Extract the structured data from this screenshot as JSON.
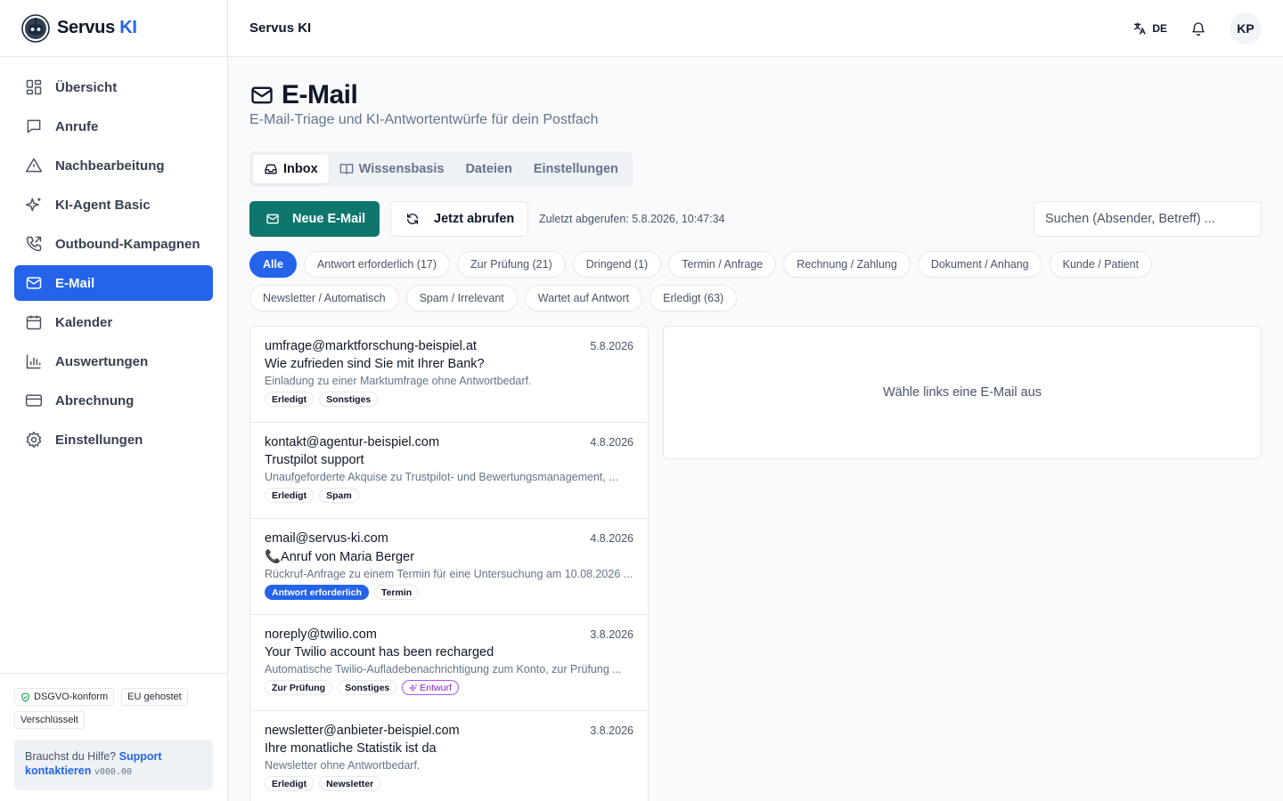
{
  "brand": {
    "name": "Servus",
    "accent": "KI",
    "accent_color": "#2563eb"
  },
  "sidebar": {
    "items": [
      {
        "label": "Übersicht",
        "icon": "grid-icon"
      },
      {
        "label": "Anrufe",
        "icon": "chat-bubble-icon"
      },
      {
        "label": "Nachbearbeitung",
        "icon": "warning-triangle-icon"
      },
      {
        "label": "KI-Agent Basic",
        "icon": "sparkles-icon"
      },
      {
        "label": "Outbound-Kampagnen",
        "icon": "phone-outgoing-icon"
      },
      {
        "label": "E-Mail",
        "icon": "mail-icon",
        "active": true
      },
      {
        "label": "Kalender",
        "icon": "calendar-icon"
      },
      {
        "label": "Auswertungen",
        "icon": "bar-chart-icon"
      },
      {
        "label": "Abrechnung",
        "icon": "credit-card-icon"
      },
      {
        "label": "Einstellungen",
        "icon": "gear-icon"
      }
    ],
    "badges": [
      "DSGVO-konform",
      "EU gehostet",
      "Verschlüsselt"
    ],
    "help": {
      "text": "Brauchst du Hilfe?",
      "link": "Support kontaktieren",
      "version": "v000.00"
    }
  },
  "topbar": {
    "title": "Servus KI",
    "language": "DE",
    "avatar": "KP"
  },
  "page": {
    "title": "E-Mail",
    "subtitle": "E-Mail-Triage und KI-Antwortentwürfe für dein Postfach",
    "tabs": [
      {
        "label": "Inbox",
        "icon": "inbox-icon",
        "active": true
      },
      {
        "label": "Wissensbasis",
        "icon": "book-icon"
      },
      {
        "label": "Dateien"
      },
      {
        "label": "Einstellungen"
      }
    ],
    "actions": {
      "new_mail": "Neue E-Mail",
      "fetch_now": "Jetzt abrufen",
      "last_fetched": "Zuletzt abgerufen: 5.8.2026, 10:47:34",
      "search_placeholder": "Suchen (Absender, Betreff) ..."
    },
    "filters": [
      {
        "label": "Alle",
        "active": true
      },
      {
        "label": "Antwort erforderlich (17)"
      },
      {
        "label": "Zur Prüfung (21)"
      },
      {
        "label": "Dringend (1)"
      },
      {
        "label": "Termin / Anfrage"
      },
      {
        "label": "Rechnung / Zahlung"
      },
      {
        "label": "Dokument / Anhang"
      },
      {
        "label": "Kunde / Patient"
      },
      {
        "label": "Newsletter / Automatisch"
      },
      {
        "label": "Spam / Irrelevant"
      },
      {
        "label": "Wartet auf Antwort"
      },
      {
        "label": "Erledigt (63)"
      }
    ],
    "emails": [
      {
        "sender": "umfrage@marktforschung-beispiel.at",
        "date": "5.8.2026",
        "subject": "Wie zufrieden sind Sie mit Ihrer Bank?",
        "preview": "Einladung zu einer Marktumfrage ohne Antwortbedarf.",
        "tags": [
          {
            "label": "Erledigt"
          },
          {
            "label": "Sonstiges"
          }
        ]
      },
      {
        "sender": "kontakt@agentur-beispiel.com",
        "date": "4.8.2026",
        "subject": "Trustpilot support",
        "preview": "Unaufgeforderte Akquise zu Trustpilot- und Bewertungsmanagement, ...",
        "tags": [
          {
            "label": "Erledigt"
          },
          {
            "label": "Spam"
          }
        ]
      },
      {
        "sender": "email@servus-ki.com",
        "date": "4.8.2026",
        "subject": "📞Anruf von Maria Berger",
        "preview": "Rückruf-Anfrage zu einem Termin für eine Untersuchung am 10.08.2026 ...",
        "tags": [
          {
            "label": "Antwort erforderlich",
            "style": "blue"
          },
          {
            "label": "Termin"
          }
        ]
      },
      {
        "sender": "noreply@twilio.com",
        "date": "3.8.2026",
        "subject": "Your Twilio account has been recharged",
        "preview": "Automatische Twilio-Aufladebenachrichtigung zum Konto, zur Prüfung ...",
        "tags": [
          {
            "label": "Zur Prüfung"
          },
          {
            "label": "Sonstiges"
          },
          {
            "label": "Entwurf",
            "style": "purple"
          }
        ]
      },
      {
        "sender": "newsletter@anbieter-beispiel.com",
        "date": "3.8.2026",
        "subject": "Ihre monatliche Statistik ist da",
        "preview": "Newsletter ohne Antwortbedarf.",
        "tags": [
          {
            "label": "Erledigt"
          },
          {
            "label": "Newsletter"
          }
        ]
      }
    ],
    "detail_placeholder": "Wähle links eine E-Mail aus"
  },
  "colors": {
    "primary": "#2563eb",
    "teal": "#0f766e",
    "purple": "#a855f7"
  }
}
